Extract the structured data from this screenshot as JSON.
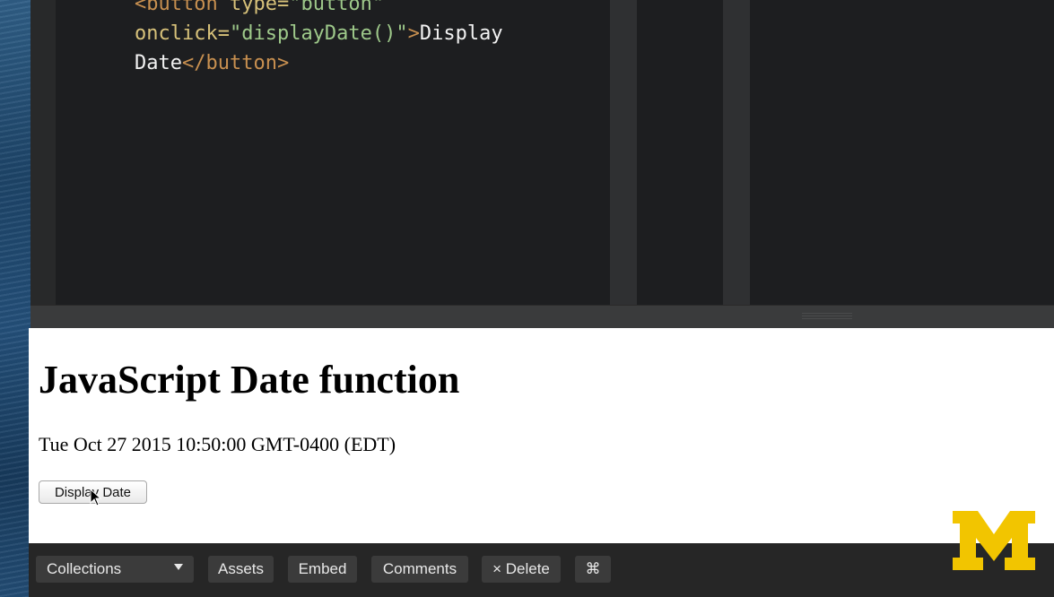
{
  "editor": {
    "code_lines": {
      "line1_tag": "<button",
      "line1_attr": " type=",
      "line1_str": "\"button\"",
      "line2_attr": "onclick=",
      "line2_str": "\"displayDate()\"",
      "line2_close": ">",
      "line2_text": "Display",
      "line3_text": "Date",
      "line3_tag": "</button>"
    }
  },
  "preview": {
    "heading": "JavaScript Date function",
    "date_output": "Tue Oct 27 2015 10:50:00 GMT-0400 (EDT)",
    "button_label": "Display Date"
  },
  "toolbar": {
    "collections_label": "Collections",
    "assets_label": "Assets",
    "embed_label": "Embed",
    "comments_label": "Comments",
    "delete_label": "× Delete",
    "command_label": "⌘"
  },
  "colors": {
    "logo_maize": "#f2c500",
    "editor_bg": "#1d1e20",
    "toolbar_bg": "#262626"
  },
  "icons": {
    "collections_dropdown": "caret-down-icon",
    "logo": "university-of-michigan-block-m-logo",
    "cursor": "mouse-pointer-icon"
  }
}
